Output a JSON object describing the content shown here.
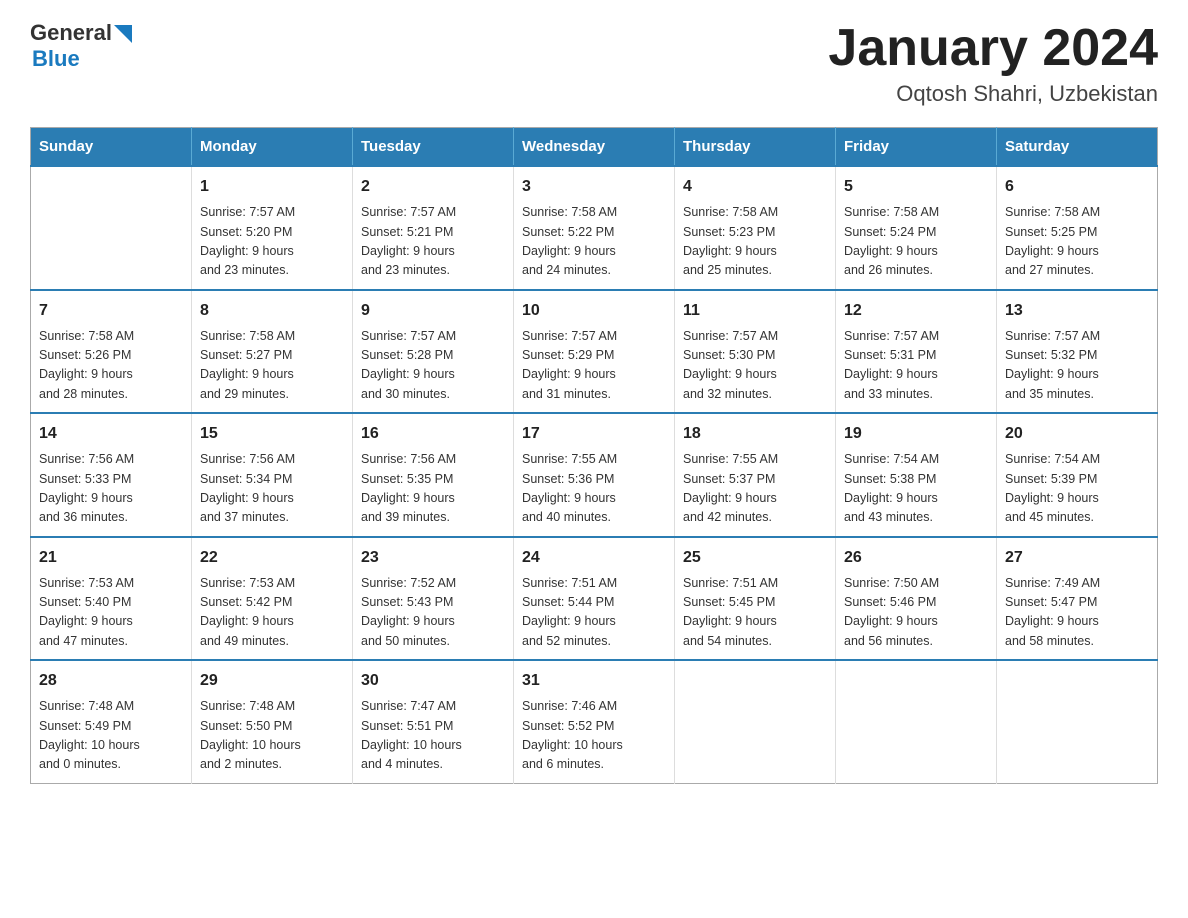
{
  "header": {
    "logo_general": "General",
    "logo_blue": "Blue",
    "month_title": "January 2024",
    "location": "Oqtosh Shahri, Uzbekistan"
  },
  "weekdays": [
    "Sunday",
    "Monday",
    "Tuesday",
    "Wednesday",
    "Thursday",
    "Friday",
    "Saturday"
  ],
  "weeks": [
    [
      {
        "day": "",
        "info": ""
      },
      {
        "day": "1",
        "info": "Sunrise: 7:57 AM\nSunset: 5:20 PM\nDaylight: 9 hours\nand 23 minutes."
      },
      {
        "day": "2",
        "info": "Sunrise: 7:57 AM\nSunset: 5:21 PM\nDaylight: 9 hours\nand 23 minutes."
      },
      {
        "day": "3",
        "info": "Sunrise: 7:58 AM\nSunset: 5:22 PM\nDaylight: 9 hours\nand 24 minutes."
      },
      {
        "day": "4",
        "info": "Sunrise: 7:58 AM\nSunset: 5:23 PM\nDaylight: 9 hours\nand 25 minutes."
      },
      {
        "day": "5",
        "info": "Sunrise: 7:58 AM\nSunset: 5:24 PM\nDaylight: 9 hours\nand 26 minutes."
      },
      {
        "day": "6",
        "info": "Sunrise: 7:58 AM\nSunset: 5:25 PM\nDaylight: 9 hours\nand 27 minutes."
      }
    ],
    [
      {
        "day": "7",
        "info": "Sunrise: 7:58 AM\nSunset: 5:26 PM\nDaylight: 9 hours\nand 28 minutes."
      },
      {
        "day": "8",
        "info": "Sunrise: 7:58 AM\nSunset: 5:27 PM\nDaylight: 9 hours\nand 29 minutes."
      },
      {
        "day": "9",
        "info": "Sunrise: 7:57 AM\nSunset: 5:28 PM\nDaylight: 9 hours\nand 30 minutes."
      },
      {
        "day": "10",
        "info": "Sunrise: 7:57 AM\nSunset: 5:29 PM\nDaylight: 9 hours\nand 31 minutes."
      },
      {
        "day": "11",
        "info": "Sunrise: 7:57 AM\nSunset: 5:30 PM\nDaylight: 9 hours\nand 32 minutes."
      },
      {
        "day": "12",
        "info": "Sunrise: 7:57 AM\nSunset: 5:31 PM\nDaylight: 9 hours\nand 33 minutes."
      },
      {
        "day": "13",
        "info": "Sunrise: 7:57 AM\nSunset: 5:32 PM\nDaylight: 9 hours\nand 35 minutes."
      }
    ],
    [
      {
        "day": "14",
        "info": "Sunrise: 7:56 AM\nSunset: 5:33 PM\nDaylight: 9 hours\nand 36 minutes."
      },
      {
        "day": "15",
        "info": "Sunrise: 7:56 AM\nSunset: 5:34 PM\nDaylight: 9 hours\nand 37 minutes."
      },
      {
        "day": "16",
        "info": "Sunrise: 7:56 AM\nSunset: 5:35 PM\nDaylight: 9 hours\nand 39 minutes."
      },
      {
        "day": "17",
        "info": "Sunrise: 7:55 AM\nSunset: 5:36 PM\nDaylight: 9 hours\nand 40 minutes."
      },
      {
        "day": "18",
        "info": "Sunrise: 7:55 AM\nSunset: 5:37 PM\nDaylight: 9 hours\nand 42 minutes."
      },
      {
        "day": "19",
        "info": "Sunrise: 7:54 AM\nSunset: 5:38 PM\nDaylight: 9 hours\nand 43 minutes."
      },
      {
        "day": "20",
        "info": "Sunrise: 7:54 AM\nSunset: 5:39 PM\nDaylight: 9 hours\nand 45 minutes."
      }
    ],
    [
      {
        "day": "21",
        "info": "Sunrise: 7:53 AM\nSunset: 5:40 PM\nDaylight: 9 hours\nand 47 minutes."
      },
      {
        "day": "22",
        "info": "Sunrise: 7:53 AM\nSunset: 5:42 PM\nDaylight: 9 hours\nand 49 minutes."
      },
      {
        "day": "23",
        "info": "Sunrise: 7:52 AM\nSunset: 5:43 PM\nDaylight: 9 hours\nand 50 minutes."
      },
      {
        "day": "24",
        "info": "Sunrise: 7:51 AM\nSunset: 5:44 PM\nDaylight: 9 hours\nand 52 minutes."
      },
      {
        "day": "25",
        "info": "Sunrise: 7:51 AM\nSunset: 5:45 PM\nDaylight: 9 hours\nand 54 minutes."
      },
      {
        "day": "26",
        "info": "Sunrise: 7:50 AM\nSunset: 5:46 PM\nDaylight: 9 hours\nand 56 minutes."
      },
      {
        "day": "27",
        "info": "Sunrise: 7:49 AM\nSunset: 5:47 PM\nDaylight: 9 hours\nand 58 minutes."
      }
    ],
    [
      {
        "day": "28",
        "info": "Sunrise: 7:48 AM\nSunset: 5:49 PM\nDaylight: 10 hours\nand 0 minutes."
      },
      {
        "day": "29",
        "info": "Sunrise: 7:48 AM\nSunset: 5:50 PM\nDaylight: 10 hours\nand 2 minutes."
      },
      {
        "day": "30",
        "info": "Sunrise: 7:47 AM\nSunset: 5:51 PM\nDaylight: 10 hours\nand 4 minutes."
      },
      {
        "day": "31",
        "info": "Sunrise: 7:46 AM\nSunset: 5:52 PM\nDaylight: 10 hours\nand 6 minutes."
      },
      {
        "day": "",
        "info": ""
      },
      {
        "day": "",
        "info": ""
      },
      {
        "day": "",
        "info": ""
      }
    ]
  ]
}
